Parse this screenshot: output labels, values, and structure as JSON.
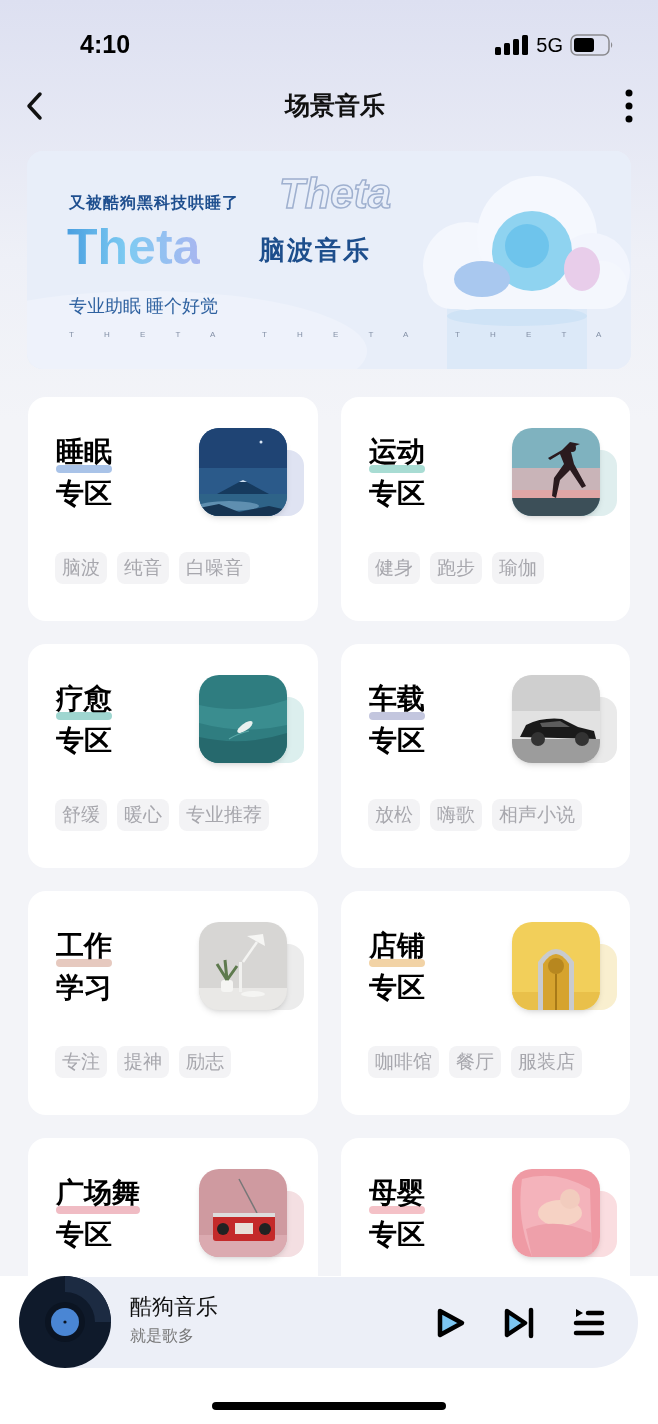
{
  "status_bar": {
    "time": "4:10",
    "network": "5G"
  },
  "nav": {
    "title": "场景音乐"
  },
  "banner": {
    "tagline": "又被酷狗黑科技哄睡了",
    "ghost_logo": "Theta",
    "logo": "Theta",
    "title": "脑波音乐",
    "subtitle": "专业助眠 睡个好觉",
    "letters": [
      "T H E T A",
      "T H E T A",
      "T H E T A"
    ]
  },
  "zones": [
    {
      "title_lines": [
        "睡眠",
        "专区"
      ],
      "color": "#a9c3e8",
      "thumbnail": {
        "kind": "picture"
      },
      "tags": [
        "脑波",
        "纯音",
        "白噪音"
      ]
    },
    {
      "title_lines": [
        "运动",
        "专区"
      ],
      "color": "#a8dcd3",
      "thumbnail": {
        "kind": "picture"
      },
      "tags": [
        "健身",
        "跑步",
        "瑜伽"
      ]
    },
    {
      "title_lines": [
        "疗愈",
        "专区"
      ],
      "color": "#9fd6d0",
      "thumbnail": {
        "kind": "picture"
      },
      "tags": [
        "舒缓",
        "暖心",
        "专业推荐"
      ]
    },
    {
      "title_lines": [
        "车载",
        "专区"
      ],
      "color": "#c3c6de",
      "thumbnail": {
        "kind": "picture"
      },
      "tags": [
        "放松",
        "嗨歌",
        "相声小说"
      ]
    },
    {
      "title_lines": [
        "工作",
        "学习"
      ],
      "color": "#e6c9bf",
      "thumbnail": {
        "kind": "picture"
      },
      "tags": [
        "专注",
        "提神",
        "励志"
      ]
    },
    {
      "title_lines": [
        "店铺",
        "专区"
      ],
      "color": "#f2d3a6",
      "thumbnail": {
        "kind": "picture"
      },
      "tags": [
        "咖啡馆",
        "餐厅",
        "服装店"
      ]
    },
    {
      "title_lines": [
        "广场舞",
        "专区"
      ],
      "color": "#f0bcc4",
      "thumbnail": {
        "kind": "picture"
      }
    },
    {
      "title_lines": [
        "母婴",
        "专区"
      ],
      "color": "#f4c1c7",
      "thumbnail": {
        "kind": "picture"
      }
    }
  ],
  "player": {
    "title": "酷狗音乐",
    "subtitle": "就是歌多"
  }
}
